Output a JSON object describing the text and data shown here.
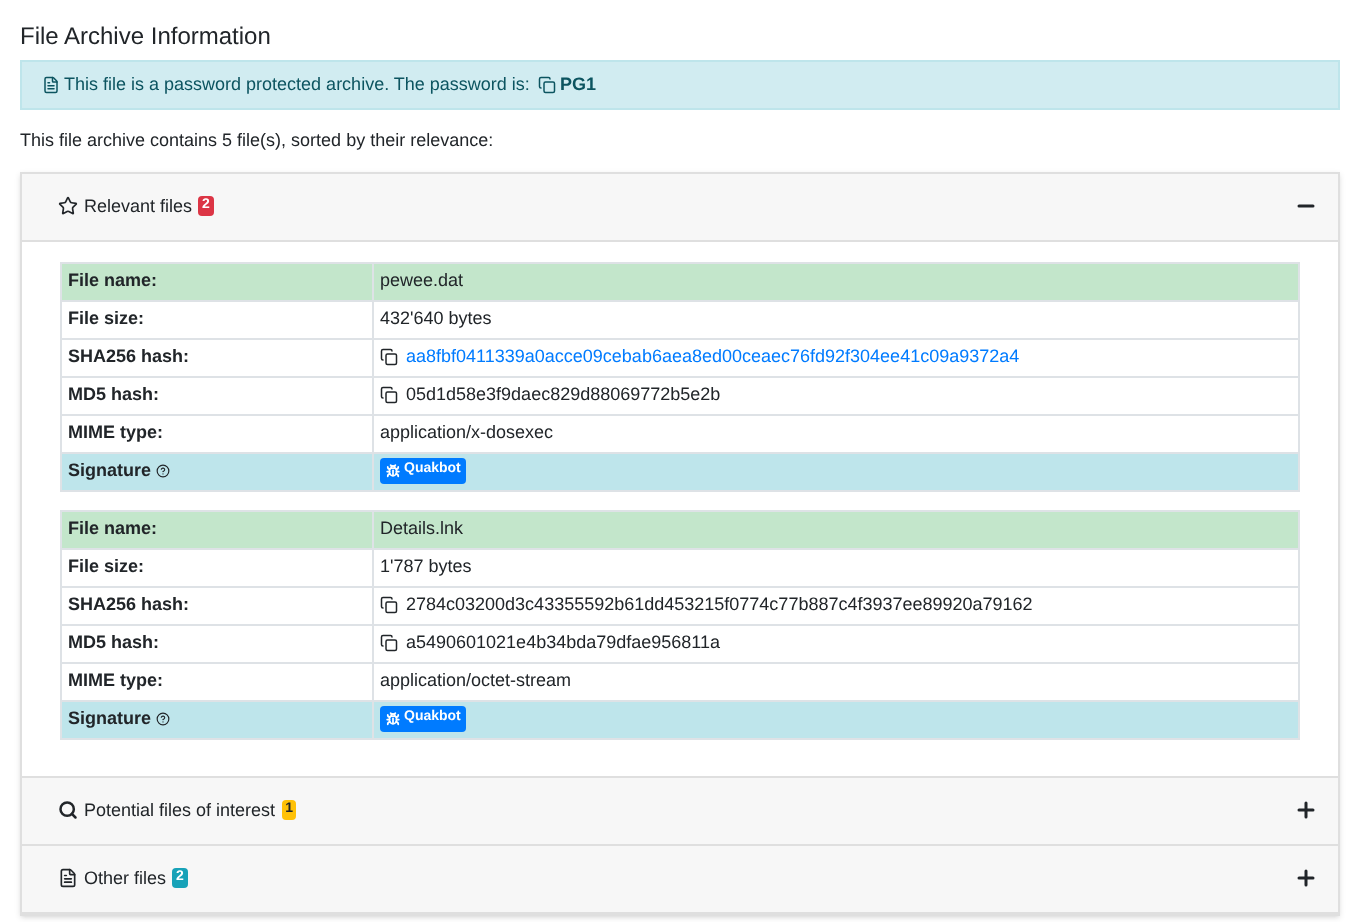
{
  "title": "File Archive Information",
  "alert": {
    "text": "This file is a password protected archive. The password is:",
    "password": "PG1"
  },
  "summary": "This file archive contains 5 file(s), sorted by their relevance:",
  "sections": [
    {
      "kind": "star",
      "label": "Relevant files",
      "badge": "2",
      "color": "#dc3545",
      "expanded": true,
      "files": [
        {
          "rows": [
            {
              "kind": "header",
              "label": "File name:",
              "value": "pewee.dat"
            },
            {
              "kind": "text",
              "label": "File size:",
              "value": "432'640 bytes"
            },
            {
              "kind": "copy_link",
              "label": "SHA256 hash:",
              "value": "aa8fbf0411339a0acce09cebab6aea8ed00ceaec76fd92f304ee41c09a9372a4"
            },
            {
              "kind": "copy",
              "label": "MD5 hash:",
              "value": "05d1d58e3f9daec829d88069772b5e2b"
            },
            {
              "kind": "text",
              "label": "MIME type:",
              "value": "application/x-dosexec"
            },
            {
              "kind": "signature",
              "label": "Signature",
              "value": "Quakbot"
            }
          ]
        },
        {
          "rows": [
            {
              "kind": "header",
              "label": "File name:",
              "value": "Details.lnk"
            },
            {
              "kind": "text",
              "label": "File size:",
              "value": "1'787 bytes"
            },
            {
              "kind": "copy",
              "label": "SHA256 hash:",
              "value": "2784c03200d3c43355592b61dd453215f0774c77b887c4f3937ee89920a79162"
            },
            {
              "kind": "copy",
              "label": "MD5 hash:",
              "value": "a5490601021e4b34bda79dfae956811a"
            },
            {
              "kind": "text",
              "label": "MIME type:",
              "value": "application/octet-stream"
            },
            {
              "kind": "signature",
              "label": "Signature",
              "value": "Quakbot"
            }
          ]
        }
      ]
    },
    {
      "kind": "search",
      "label": "Potential files of interest",
      "badge": "1",
      "color": "#ffc107",
      "expanded": false
    },
    {
      "kind": "file",
      "label": "Other files",
      "badge": "2",
      "color": "#17a2b8",
      "expanded": false
    }
  ]
}
